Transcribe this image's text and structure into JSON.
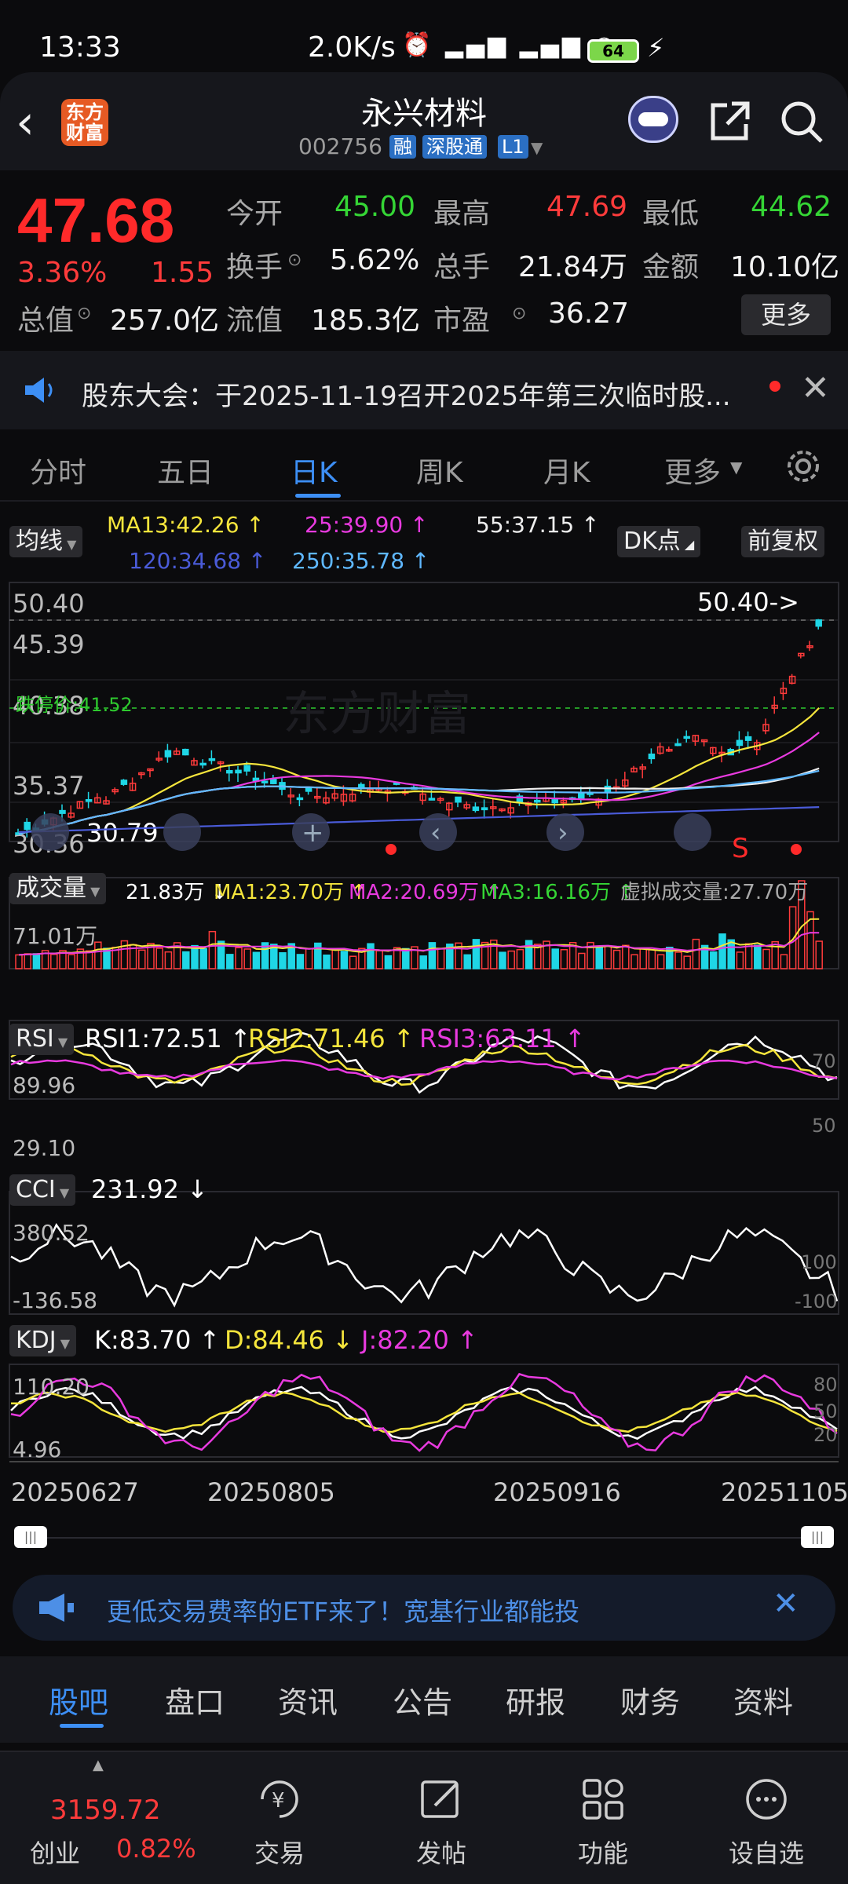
{
  "status_bar": {
    "time": "13:33",
    "network_speed": "2.0K/s",
    "battery": "64"
  },
  "header": {
    "title": "永兴材料",
    "code": "002756",
    "tags": [
      "融",
      "深股通",
      "L1"
    ],
    "logo_text": [
      "东方",
      "财富"
    ]
  },
  "quote": {
    "price": "47.68",
    "change_pct": "3.36%",
    "change": "1.55",
    "rows": [
      [
        {
          "label": "今开",
          "value": "45.00",
          "color": "#35d635"
        },
        {
          "label": "最高",
          "value": "47.69",
          "color": "#ff3b3b"
        },
        {
          "label": "最低",
          "value": "44.62",
          "color": "#35d635"
        }
      ],
      [
        {
          "label": "换手",
          "value": "5.62%",
          "color": "#f2f2f2"
        },
        {
          "label": "总手",
          "value": "21.84万",
          "color": "#f2f2f2"
        },
        {
          "label": "金额",
          "value": "10.10亿",
          "color": "#f2f2f2"
        }
      ],
      [
        {
          "label": "总值",
          "value": "257.0亿",
          "color": "#f2f2f2"
        },
        {
          "label": "流值",
          "value": "185.3亿",
          "color": "#f2f2f2"
        },
        {
          "label": "市盈",
          "value": "36.27",
          "color": "#f2f2f2"
        }
      ]
    ],
    "more_label": "更多"
  },
  "notice": {
    "text": "股东大会：于2025-11-19召开2025年第三次临时股..."
  },
  "tabs": {
    "items": [
      "分时",
      "五日",
      "日K",
      "周K",
      "月K",
      "更多"
    ],
    "active": "日K"
  },
  "kline": {
    "indicator_label": "均线",
    "ma": [
      {
        "text": "MA13:42.26 ↑",
        "color": "#f5e53c"
      },
      {
        "text": "25:39.90 ↑",
        "color": "#e83adf"
      },
      {
        "text": "55:37.15 ↑",
        "color": "#eeeeee"
      },
      {
        "text": "120:34.68 ↑",
        "color": "#4a5bd8"
      },
      {
        "text": "250:35.78 ↑",
        "color": "#5fb8ff"
      }
    ],
    "dk_label": "DK点",
    "adjust_label": "前复权",
    "y_labels": [
      "50.40",
      "45.39",
      "40.38",
      "35.37",
      "30.36"
    ],
    "high_marker": "50.40->",
    "low_marker": "30.79",
    "limit_label": "跌停价:41.52",
    "signal_label": "S",
    "watermark": "东方财富"
  },
  "volume": {
    "label": "成交量",
    "value": "21.83万 ↓",
    "ma1": "MA1:23.70万 ↑",
    "ma2": "MA2:20.69万 ↑",
    "ma3": "MA3:16.16万 ↑",
    "virtual": "虚拟成交量:27.70万",
    "max_label": "71.01万"
  },
  "rsi": {
    "label": "RSI",
    "rsi1": "RSI1:72.51 ↑",
    "rsi2": "RSI2:71.46 ↑",
    "rsi3": "RSI3:63.11 ↑",
    "y_top": "89.96",
    "y_bottom": "29.10",
    "ref_top": "70",
    "ref_bottom": "50"
  },
  "cci": {
    "label": "CCI",
    "value": "231.92 ↓",
    "y_top": "380.52",
    "y_bottom": "-136.58",
    "ref_top": "100",
    "ref_bottom": "-100"
  },
  "kdj": {
    "label": "KDJ",
    "k": "K:83.70 ↑",
    "d": "D:84.46 ↓",
    "j": "J:82.20 ↑",
    "y_top": "110.20",
    "y_bottom": "4.96",
    "refs": [
      "80",
      "50",
      "20"
    ]
  },
  "dates": [
    "20250627",
    "20250805",
    "20250916",
    "20251105"
  ],
  "ad": {
    "text": "更低交易费率的ETF来了！宽基行业都能投"
  },
  "bottom_tabs": {
    "items": [
      "股吧",
      "盘口",
      "资讯",
      "公告",
      "研报",
      "财务",
      "资料"
    ],
    "active": "股吧"
  },
  "nav": {
    "index_value": "3159.72",
    "index_name": "创业",
    "index_pct": "0.82%",
    "items": [
      {
        "label": "交易",
        "icon": "yen-icon"
      },
      {
        "label": "发帖",
        "icon": "edit-icon"
      },
      {
        "label": "功能",
        "icon": "grid-icon"
      },
      {
        "label": "设自选",
        "icon": "more-dots-icon"
      }
    ]
  }
}
